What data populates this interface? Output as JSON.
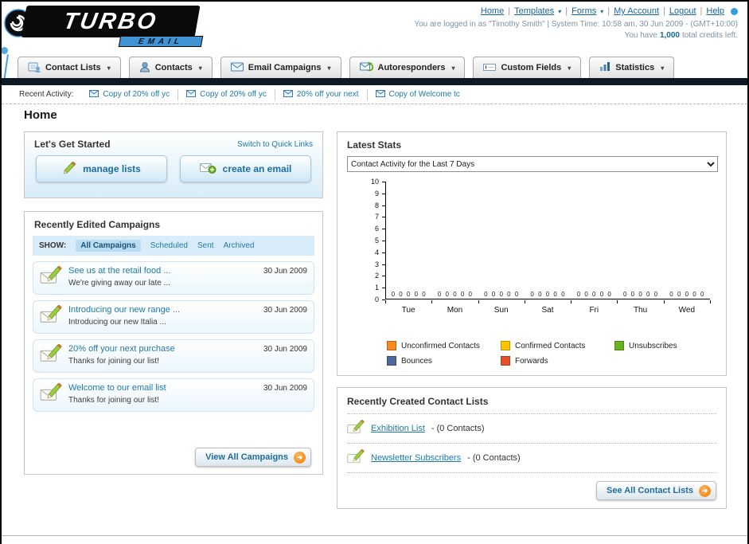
{
  "icons": {
    "chevron_down": "▾",
    "arrow_right": "➜",
    "pipe": "|"
  },
  "header": {
    "logo_title": "TURBO",
    "logo_subtitle": "EMAIL",
    "links": [
      "Home",
      "Templates",
      "Forms",
      "My Account",
      "Logout",
      "Help"
    ],
    "login_info": "You are logged in as \"Timothy Smith\" | System Time: 10:58 am, 30 Jun 2009 - (GMT+10:00)",
    "credits_prefix": "You have",
    "credits_value": "1,000",
    "credits_suffix": "total credits left."
  },
  "nav": {
    "tabs": [
      {
        "label": "Contact Lists"
      },
      {
        "label": "Contacts"
      },
      {
        "label": "Email Campaigns"
      },
      {
        "label": "Autoresponders"
      },
      {
        "label": "Custom Fields"
      },
      {
        "label": "Statistics"
      }
    ]
  },
  "recent_activity": {
    "label": "Recent Activity:",
    "items": [
      "Copy of 20% off yc",
      "Copy of 20% off yc",
      "20% off your next",
      "Copy of Welcome tc"
    ]
  },
  "page": {
    "title": "Home"
  },
  "get_started": {
    "title": "Let's Get Started",
    "switch_link": "Switch to Quick Links",
    "manage_lists_button": "manage lists",
    "create_email_button": "create an email"
  },
  "campaigns": {
    "title": "Recently Edited Campaigns",
    "show_label": "SHOW:",
    "filters": [
      "All Campaigns",
      "Scheduled",
      "Sent",
      "Archived"
    ],
    "active_filter": "All Campaigns",
    "items": [
      {
        "title": "See us at the retail food ...",
        "subtitle": "We're giving away our late ...",
        "date": "30 Jun 2009"
      },
      {
        "title": "Introducing our new range ...",
        "subtitle": "Introducing our new Italia ...",
        "date": "30 Jun 2009"
      },
      {
        "title": "20% off your next purchase",
        "subtitle": "Thanks for joining our list!",
        "date": "30 Jun 2009"
      },
      {
        "title": "Welcome to our email list",
        "subtitle": "Thanks for joining our list!",
        "date": "30 Jun 2009"
      }
    ],
    "view_all_button": "View All Campaigns"
  },
  "stats": {
    "title": "Latest Stats",
    "period_selector": "Contact Activity for the Last 7 Days"
  },
  "chart_data": {
    "type": "bar",
    "title": "Contact Activity for the Last 7 Days",
    "categories": [
      "Tue",
      "Mon",
      "Sun",
      "Sat",
      "Fri",
      "Thu",
      "Wed"
    ],
    "series": [
      {
        "name": "Unconfirmed Contacts",
        "color": "#f6891f",
        "values": [
          0,
          0,
          0,
          0,
          0,
          0,
          0
        ]
      },
      {
        "name": "Confirmed Contacts",
        "color": "#fdc500",
        "values": [
          0,
          0,
          0,
          0,
          0,
          0,
          0
        ]
      },
      {
        "name": "Unsubscribes",
        "color": "#6ab023",
        "values": [
          0,
          0,
          0,
          0,
          0,
          0,
          0
        ]
      },
      {
        "name": "Bounces",
        "color": "#51689b",
        "values": [
          0,
          0,
          0,
          0,
          0,
          0,
          0
        ]
      },
      {
        "name": "Forwards",
        "color": "#e8502a",
        "values": [
          0,
          0,
          0,
          0,
          0,
          0,
          0
        ]
      }
    ],
    "ylim": [
      0,
      10
    ],
    "ytick_step": 1,
    "grid": false,
    "show_value_labels": true,
    "legend_position": "bottom"
  },
  "contact_lists": {
    "title": "Recently Created Contact Lists",
    "items": [
      {
        "name": "Exhibition List",
        "detail": "- (0 Contacts)"
      },
      {
        "name": "Newsletter Subscribers",
        "detail": "- (0 Contacts)"
      }
    ],
    "see_all_button": "See All Contact Lists"
  }
}
